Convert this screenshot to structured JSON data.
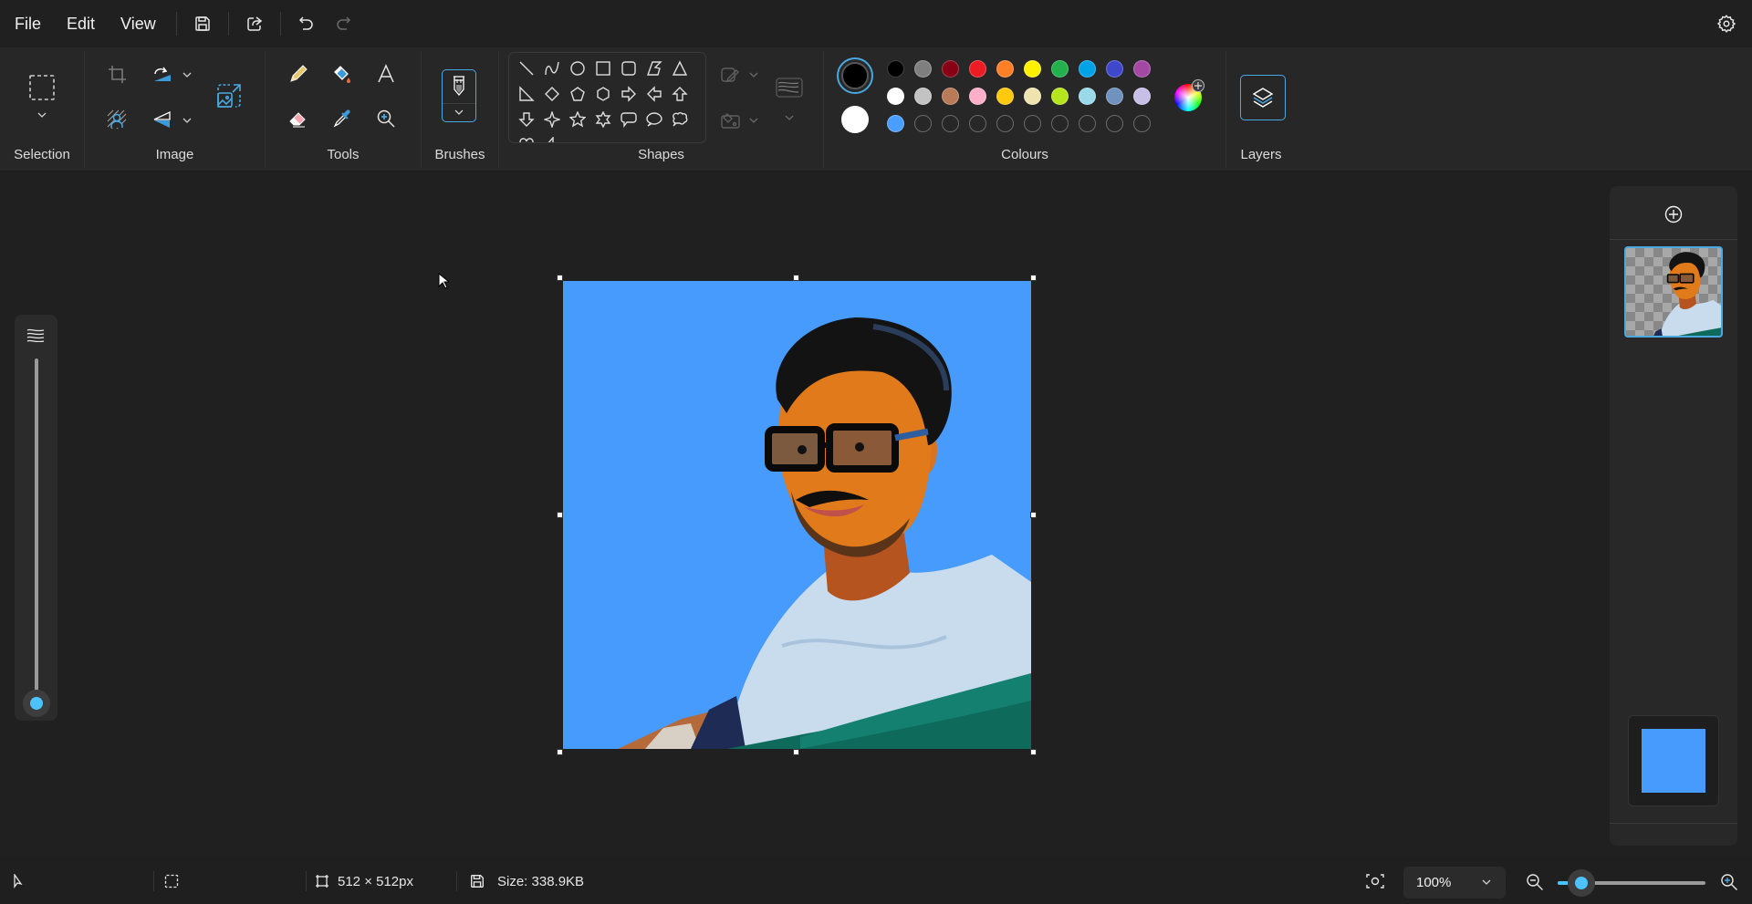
{
  "menubar": {
    "items": [
      "File",
      "Edit",
      "View"
    ],
    "save_icon": "save-icon",
    "share_icon": "share-icon",
    "undo_icon": "undo-icon",
    "redo_icon": "redo-icon",
    "settings_icon": "gear-icon"
  },
  "ribbon": {
    "groups": {
      "selection": "Selection",
      "image": "Image",
      "tools": "Tools",
      "brushes": "Brushes",
      "shapes": "Shapes",
      "colours": "Colours",
      "layers": "Layers"
    },
    "image_tools": [
      "crop",
      "rotate",
      "remove-background",
      "flip",
      "resize"
    ],
    "tools": [
      "pencil",
      "fill",
      "text",
      "eraser",
      "colour-picker",
      "magnifier"
    ],
    "shapes": [
      "line",
      "curve",
      "oval",
      "rectangle",
      "rounded-rectangle",
      "polygon",
      "triangle",
      "right-triangle",
      "diamond",
      "pentagon",
      "hexagon",
      "right-arrow",
      "left-arrow",
      "up-arrow",
      "down-arrow",
      "four-point-star",
      "five-point-star",
      "six-point-star",
      "rounded-callout",
      "oval-callout",
      "cloud-callout",
      "heart",
      "lightning"
    ]
  },
  "colours": {
    "primary": "#000000",
    "secondary": "#ffffff",
    "row1": [
      "#000000",
      "#7f7f7f",
      "#880015",
      "#ed1c24",
      "#ff7f27",
      "#fff200",
      "#22b14c",
      "#00a2e8",
      "#3f48cc",
      "#a349a4"
    ],
    "row2": [
      "#ffffff",
      "#c3c3c3",
      "#b97a57",
      "#ffaec9",
      "#ffc90e",
      "#efe4b0",
      "#b5e61d",
      "#99d9ea",
      "#7092be",
      "#c8bfe7"
    ],
    "row3": [
      "#4a9eff",
      "",
      "",
      "",
      "",
      "",
      "",
      "",
      "",
      ""
    ]
  },
  "canvas": {
    "background_color": "#469bfd"
  },
  "opacity_slider": {
    "value": 1.0
  },
  "layers_panel": {
    "add_layer_icon": "add-icon",
    "background_color": "#469bfd"
  },
  "statusbar": {
    "dimensions": "512 × 512px",
    "size": "Size: 338.9KB",
    "zoom": "100%",
    "zoom_slider_value": 0.16
  }
}
